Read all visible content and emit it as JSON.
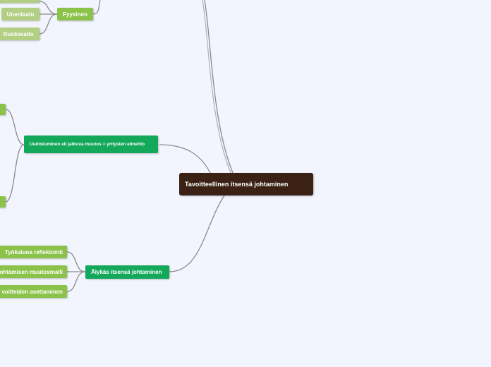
{
  "colors": {
    "background": "#f3f5fe",
    "central": "#3b2114",
    "main_topic": "#13a85a",
    "subtopic": "#8bc34a",
    "leaf": "#b2cf84",
    "connector": "#8a8a8a"
  },
  "mindmap": {
    "central": "Tavoitteellinen itsensä johtaminen",
    "fyysinen": {
      "label": "Fyysinen",
      "children": [
        "Unenlaatu",
        "Ruokavalio"
      ]
    },
    "uudistuminen": {
      "label": "Uudistuminen eli jatkuva muutos = yritysten elinehto"
    },
    "alykas": {
      "label": "Älykäs itsensä johtaminen",
      "children": [
        "Työkaluna reflektointi",
        "johtamisen muutosmalli",
        "voitteiden asettaminen"
      ]
    }
  }
}
